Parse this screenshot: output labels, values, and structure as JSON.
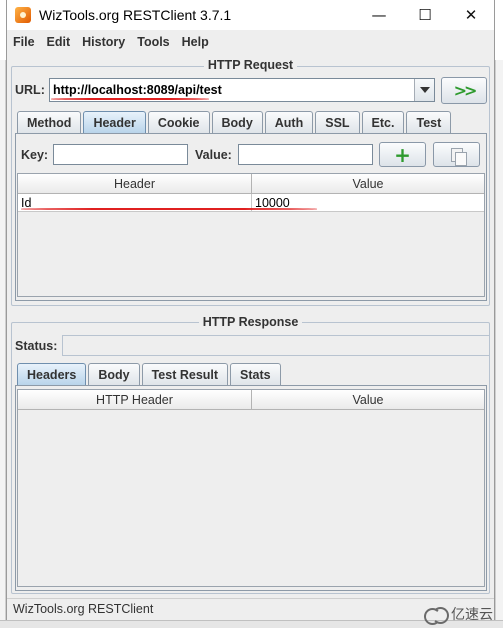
{
  "window": {
    "title": "WizTools.org RESTClient 3.7.1",
    "minimize_symbol": "—",
    "maximize_symbol": "☐",
    "close_symbol": "✕"
  },
  "menubar": {
    "items": [
      {
        "label": "File"
      },
      {
        "label": "Edit"
      },
      {
        "label": "History"
      },
      {
        "label": "Tools"
      },
      {
        "label": "Help"
      }
    ]
  },
  "request": {
    "panel_title": "HTTP Request",
    "url_label": "URL:",
    "url_value": "http://localhost:8089/api/test",
    "go_symbol": ">>",
    "tabs": [
      {
        "label": "Method",
        "active": false
      },
      {
        "label": "Header",
        "active": true
      },
      {
        "label": "Cookie",
        "active": false
      },
      {
        "label": "Body",
        "active": false
      },
      {
        "label": "Auth",
        "active": false
      },
      {
        "label": "SSL",
        "active": false
      },
      {
        "label": "Etc.",
        "active": false
      },
      {
        "label": "Test",
        "active": false
      }
    ],
    "key_label": "Key:",
    "value_label": "Value:",
    "add_symbol": "+",
    "header_table": {
      "columns": [
        "Header",
        "Value"
      ],
      "rows": [
        [
          "Id",
          "10000"
        ]
      ]
    }
  },
  "response": {
    "panel_title": "HTTP Response",
    "status_label": "Status:",
    "status_value": "",
    "tabs": [
      {
        "label": "Headers",
        "active": true
      },
      {
        "label": "Body",
        "active": false
      },
      {
        "label": "Test Result",
        "active": false
      },
      {
        "label": "Stats",
        "active": false
      }
    ],
    "headers_table": {
      "columns": [
        "HTTP Header",
        "Value"
      ]
    }
  },
  "statusbar": {
    "text": "WizTools.org RESTClient"
  },
  "watermark": {
    "text": "亿速云"
  },
  "colors": {
    "annotation_red": "#e02020",
    "go_green": "#2e9a2e",
    "active_tab": "#b9d4ea"
  }
}
